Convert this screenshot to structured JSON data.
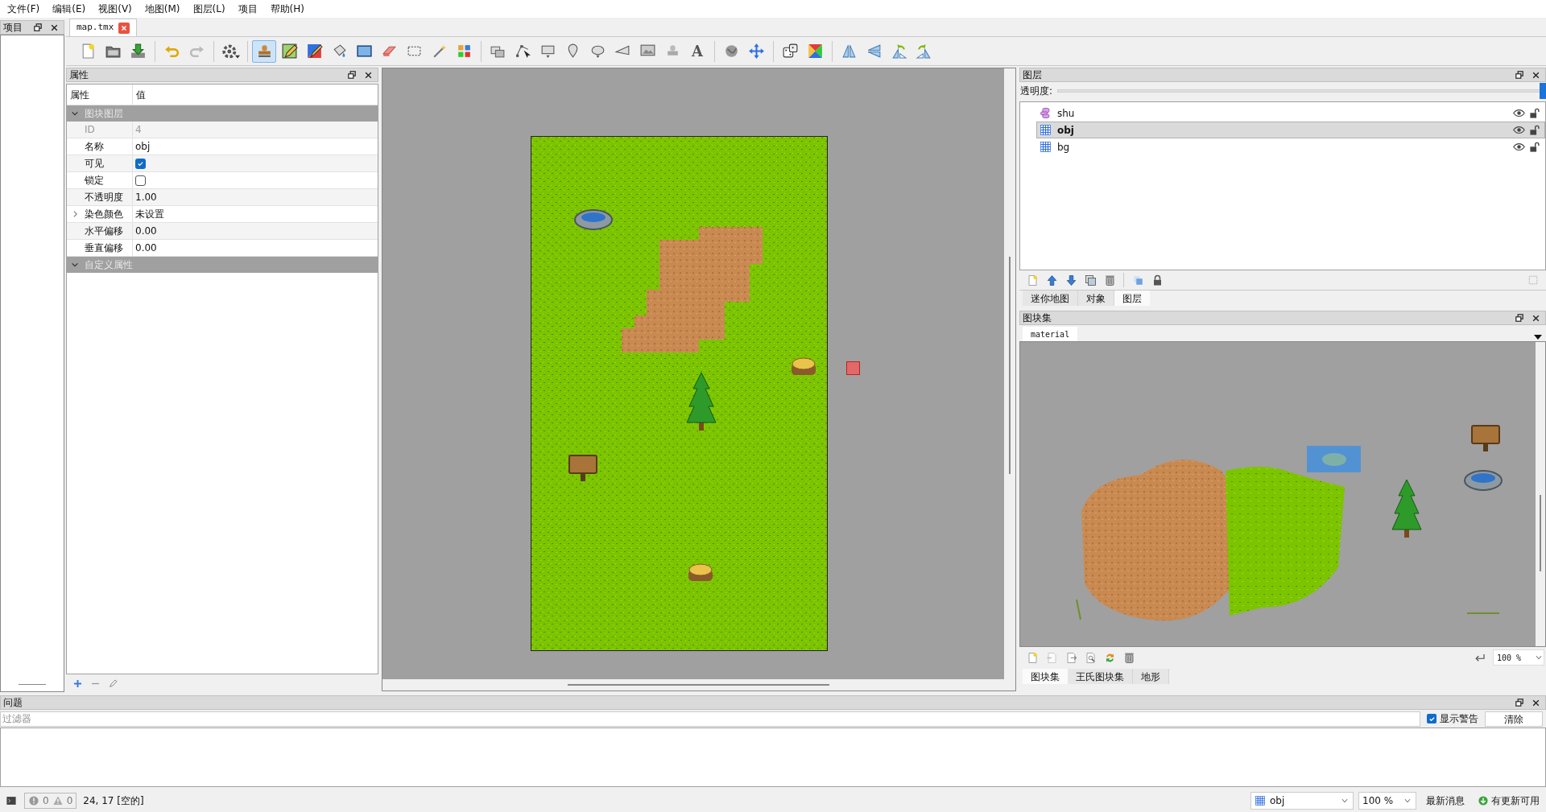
{
  "menu": [
    "文件(F)",
    "编辑(E)",
    "视图(V)",
    "地图(M)",
    "图层(L)",
    "项目",
    "帮助(H)"
  ],
  "project_panel": {
    "title": "项目"
  },
  "document_tabs": [
    {
      "label": "map.tmx",
      "selected": true
    }
  ],
  "toolbar_groups": [
    [
      {
        "kind": "new",
        "selected": false
      },
      {
        "kind": "open",
        "selected": false
      },
      {
        "kind": "save",
        "selected": false
      }
    ],
    [
      {
        "kind": "undo",
        "selected": false
      },
      {
        "kind": "redo",
        "selected": false
      }
    ],
    [
      {
        "kind": "commands",
        "selected": false
      }
    ],
    [
      {
        "kind": "stamp",
        "selected": true
      },
      {
        "kind": "terrain",
        "selected": false
      },
      {
        "kind": "wang",
        "selected": false
      },
      {
        "kind": "bucket",
        "selected": false
      },
      {
        "kind": "shapefill",
        "selected": false
      },
      {
        "kind": "eraser",
        "selected": false
      },
      {
        "kind": "rectselect",
        "selected": false
      },
      {
        "kind": "wand",
        "selected": false
      },
      {
        "kind": "sameselect",
        "selected": false
      }
    ],
    [
      {
        "kind": "selobj",
        "selected": false
      },
      {
        "kind": "editpoly",
        "selected": false
      },
      {
        "kind": "insrect",
        "selected": false
      },
      {
        "kind": "pin",
        "selected": false
      },
      {
        "kind": "ellipse",
        "selected": false
      },
      {
        "kind": "polygon",
        "selected": false
      },
      {
        "kind": "instile",
        "selected": false
      },
      {
        "kind": "template",
        "selected": false
      },
      {
        "kind": "text",
        "glyph": "A",
        "selected": false
      }
    ],
    [
      {
        "kind": "globe",
        "selected": false
      },
      {
        "kind": "move",
        "selected": false
      }
    ],
    [
      {
        "kind": "dice",
        "selected": false
      },
      {
        "kind": "wangrandom",
        "selected": false
      }
    ],
    [
      {
        "kind": "fliph",
        "selected": false
      },
      {
        "kind": "flipv",
        "selected": false
      },
      {
        "kind": "rotl",
        "selected": false
      },
      {
        "kind": "rotr",
        "selected": false
      }
    ]
  ],
  "properties": {
    "title": "属性",
    "columns": [
      "属性",
      "值"
    ],
    "rows": [
      {
        "kind": "group",
        "label": "图块图层",
        "expanded": true
      },
      {
        "kind": "text",
        "label": "ID",
        "value": "4",
        "disabled": true
      },
      {
        "kind": "text",
        "label": "名称",
        "value": "obj",
        "disabled": false
      },
      {
        "kind": "check",
        "label": "可见",
        "checked": true
      },
      {
        "kind": "check",
        "label": "锁定",
        "checked": false
      },
      {
        "kind": "text",
        "label": "不透明度",
        "value": "1.00",
        "disabled": false
      },
      {
        "kind": "text",
        "label": "染色颜色",
        "value": "未设置",
        "disabled": false,
        "expanded": false
      },
      {
        "kind": "text",
        "label": "水平偏移",
        "value": "0.00",
        "disabled": false
      },
      {
        "kind": "text",
        "label": "垂直偏移",
        "value": "0.00",
        "disabled": false
      },
      {
        "kind": "group",
        "label": "自定义属性",
        "expanded": true
      }
    ]
  },
  "layers": {
    "title": "图层",
    "opacity_label": "透明度:",
    "opacity": {
      "level": 1
    },
    "items": [
      {
        "name": "shu",
        "kind": "object",
        "selected": false,
        "visible": true,
        "locked": false
      },
      {
        "name": "obj",
        "kind": "tile",
        "selected": true,
        "visible": true,
        "locked": false
      },
      {
        "name": "bg",
        "kind": "tile",
        "selected": false,
        "visible": true,
        "locked": false
      }
    ],
    "tabs": [
      {
        "label": "迷你地图",
        "selected": false
      },
      {
        "label": "对象",
        "selected": false
      },
      {
        "label": "图层",
        "selected": true
      }
    ]
  },
  "tilesets": {
    "title": "图块集",
    "tabs": [
      {
        "label": "material",
        "selected": true
      }
    ],
    "zoom": "100 %",
    "bottom_tabs": [
      {
        "label": "图块集",
        "selected": true
      },
      {
        "label": "王氏图块集",
        "selected": false
      },
      {
        "label": "地形",
        "selected": false
      }
    ]
  },
  "issues": {
    "title": "问题",
    "filter_placeholder": "过滤器",
    "show_warnings": {
      "label": "显示警告",
      "checked": true
    },
    "clear_button": "清除"
  },
  "status_bar": {
    "errors": "0",
    "warnings": "0",
    "position": "24, 17 [空的]",
    "layer": "obj",
    "zoom": "100 %",
    "news": "最新消息",
    "update": "有更新可用"
  }
}
